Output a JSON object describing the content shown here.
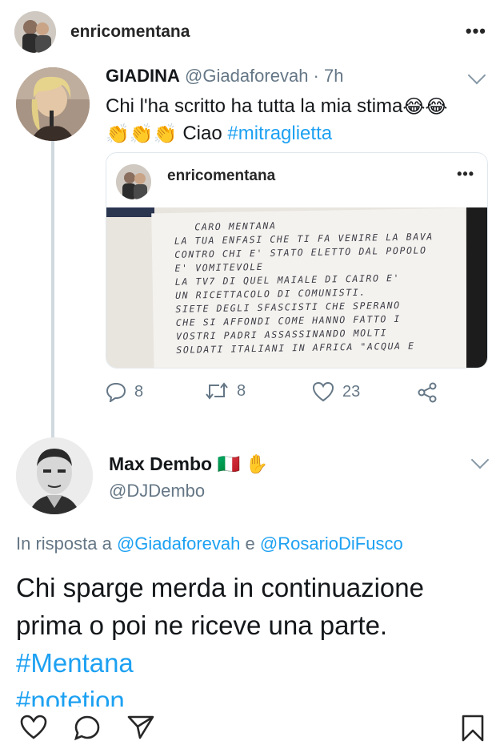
{
  "header": {
    "username": "enricomentana",
    "more": "•••"
  },
  "tweet1": {
    "display_name": "GIADINA",
    "handle_time": "@Giadaforevah · 7h",
    "line1_text": "Chi l'ha scritto ha tutta la mia stima",
    "line1_emojis": "😂😂",
    "line2_emojis": "👏👏👏",
    "line2_text": "Ciao",
    "hashtag": "#mitraglietta"
  },
  "embedded_post": {
    "username": "enricomentana",
    "more": "•••",
    "letter_text": "   CARO MENTANA\nLA TUA ENFASI CHE TI FA VENIRE LA BAVA\nCONTRO CHI E' STATO ELETTO DAL POPOLO\nE' VOMITEVOLE\nLA TV7 DI QUEL MAIALE DI CAIRO E'\nUN RICETTACOLO DI COMUNISTI.\nSIETE DEGLI SFASCISTI CHE SPERANO\nCHE SI AFFONDI COME HANNO FATTO I\nVOSTRI PADRI ASSASSINANDO MOLTI\nSOLDATI ITALIANI IN AFRICA \"ACQUA E"
  },
  "tweet1_actions": {
    "replies": "8",
    "retweets": "8",
    "likes": "23"
  },
  "tweet2": {
    "display_name": "Max Dembo",
    "name_emojis": "🇮🇹 ✋",
    "handle": "@DJDembo",
    "reply_prefix": "In risposta a",
    "mention1": "@Giadaforevah",
    "reply_and": "e",
    "mention2": "@RosarioDiFusco",
    "body_text": "Chi sparge merda in continuazione prima o poi ne riceve una parte.",
    "hashtag1": "#Mentana",
    "hashtag2": "#notetion"
  },
  "colors": {
    "link": "#1da1f2",
    "muted": "#657786",
    "text": "#14171a"
  },
  "icons": [
    "heart-icon",
    "comment-icon",
    "share-icon",
    "bookmark-icon",
    "reply-icon",
    "retweet-icon",
    "like-icon",
    "tweet-share-icon",
    "chevron-down-icon"
  ]
}
